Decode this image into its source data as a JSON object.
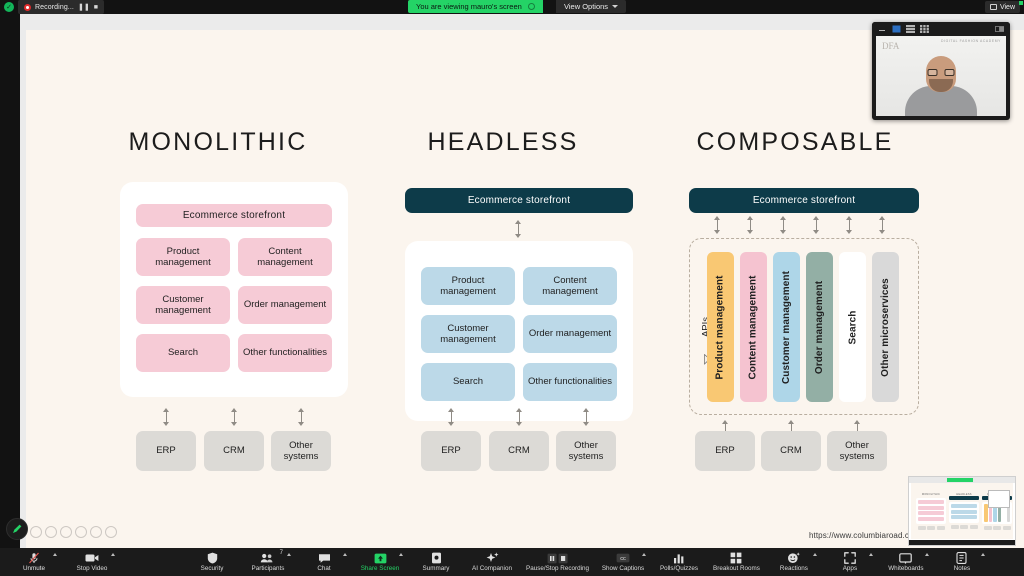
{
  "topbar": {
    "recording_label": "Recording...",
    "pause_icon": "pause-icon",
    "stop_icon": "stop-icon",
    "share_banner": "You are viewing mauro's screen",
    "view_options_label": "View Options",
    "view_button_label": "View"
  },
  "slide": {
    "url": "https://www.columbiaroad.com/com",
    "columns": [
      {
        "title": "MONOLITHIC",
        "storefront": "Ecommerce storefront",
        "storefront_style": "pink",
        "modules": [
          "Product management",
          "Content management",
          "Customer management",
          "Order management",
          "Search",
          "Other functionalities"
        ],
        "systems": [
          "ERP",
          "CRM",
          "Other systems"
        ]
      },
      {
        "title": "HEADLESS",
        "storefront": "Ecommerce storefront",
        "storefront_style": "dark",
        "modules": [
          "Product management",
          "Content management",
          "Customer management",
          "Order management",
          "Search",
          "Other functionalities"
        ],
        "systems": [
          "ERP",
          "CRM",
          "Other systems"
        ]
      },
      {
        "title": "COMPOSABLE",
        "storefront": "Ecommerce storefront",
        "storefront_style": "dark",
        "api_label": "APIs",
        "services": [
          {
            "name": "Product management",
            "color": "#f9c873"
          },
          {
            "name": "Content management",
            "color": "#f5c3d0"
          },
          {
            "name": "Customer management",
            "color": "#aed6e8"
          },
          {
            "name": "Order management",
            "color": "#93afa5"
          },
          {
            "name": "Search",
            "color": "#ffffff"
          },
          {
            "name": "Other microservices",
            "color": "#d9d9d9"
          }
        ],
        "systems": [
          "ERP",
          "CRM",
          "Other systems"
        ]
      }
    ]
  },
  "selfview": {
    "brand": "DIGITAL FASHION ACADEMY",
    "logo": "DFA"
  },
  "toolbar": {
    "items": [
      {
        "label": "Unmute",
        "icon": "microphone-muted-icon",
        "caret": true,
        "state": "muted"
      },
      {
        "label": "Stop Video",
        "icon": "video-camera-icon",
        "caret": true,
        "state": "normal"
      },
      {
        "label": "Security",
        "icon": "shield-icon",
        "caret": false,
        "state": "normal"
      },
      {
        "label": "Participants",
        "icon": "participants-icon",
        "caret": true,
        "state": "normal",
        "badge": "7"
      },
      {
        "label": "Chat",
        "icon": "chat-bubble-icon",
        "caret": true,
        "state": "normal"
      },
      {
        "label": "Share Screen",
        "icon": "share-screen-icon",
        "caret": true,
        "state": "active"
      },
      {
        "label": "Summary",
        "icon": "summary-doc-icon",
        "caret": false,
        "state": "normal"
      },
      {
        "label": "AI Companion",
        "icon": "ai-sparkle-icon",
        "caret": false,
        "state": "normal"
      },
      {
        "label": "Pause/Stop Recording",
        "icon": "pause-stop-icon",
        "caret": false,
        "state": "normal"
      },
      {
        "label": "Show Captions",
        "icon": "closed-caption-icon",
        "caret": true,
        "state": "normal"
      },
      {
        "label": "Polls/Quizzes",
        "icon": "bar-chart-icon",
        "caret": false,
        "state": "normal"
      },
      {
        "label": "Breakout Rooms",
        "icon": "grid-squares-icon",
        "caret": false,
        "state": "normal"
      },
      {
        "label": "Reactions",
        "icon": "emoji-reaction-icon",
        "caret": true,
        "state": "normal"
      },
      {
        "label": "Apps",
        "icon": "apps-icon",
        "caret": true,
        "state": "normal"
      },
      {
        "label": "Whiteboards",
        "icon": "whiteboard-icon",
        "caret": true,
        "state": "normal"
      },
      {
        "label": "Notes",
        "icon": "notes-icon",
        "caret": true,
        "state": "normal"
      }
    ]
  }
}
